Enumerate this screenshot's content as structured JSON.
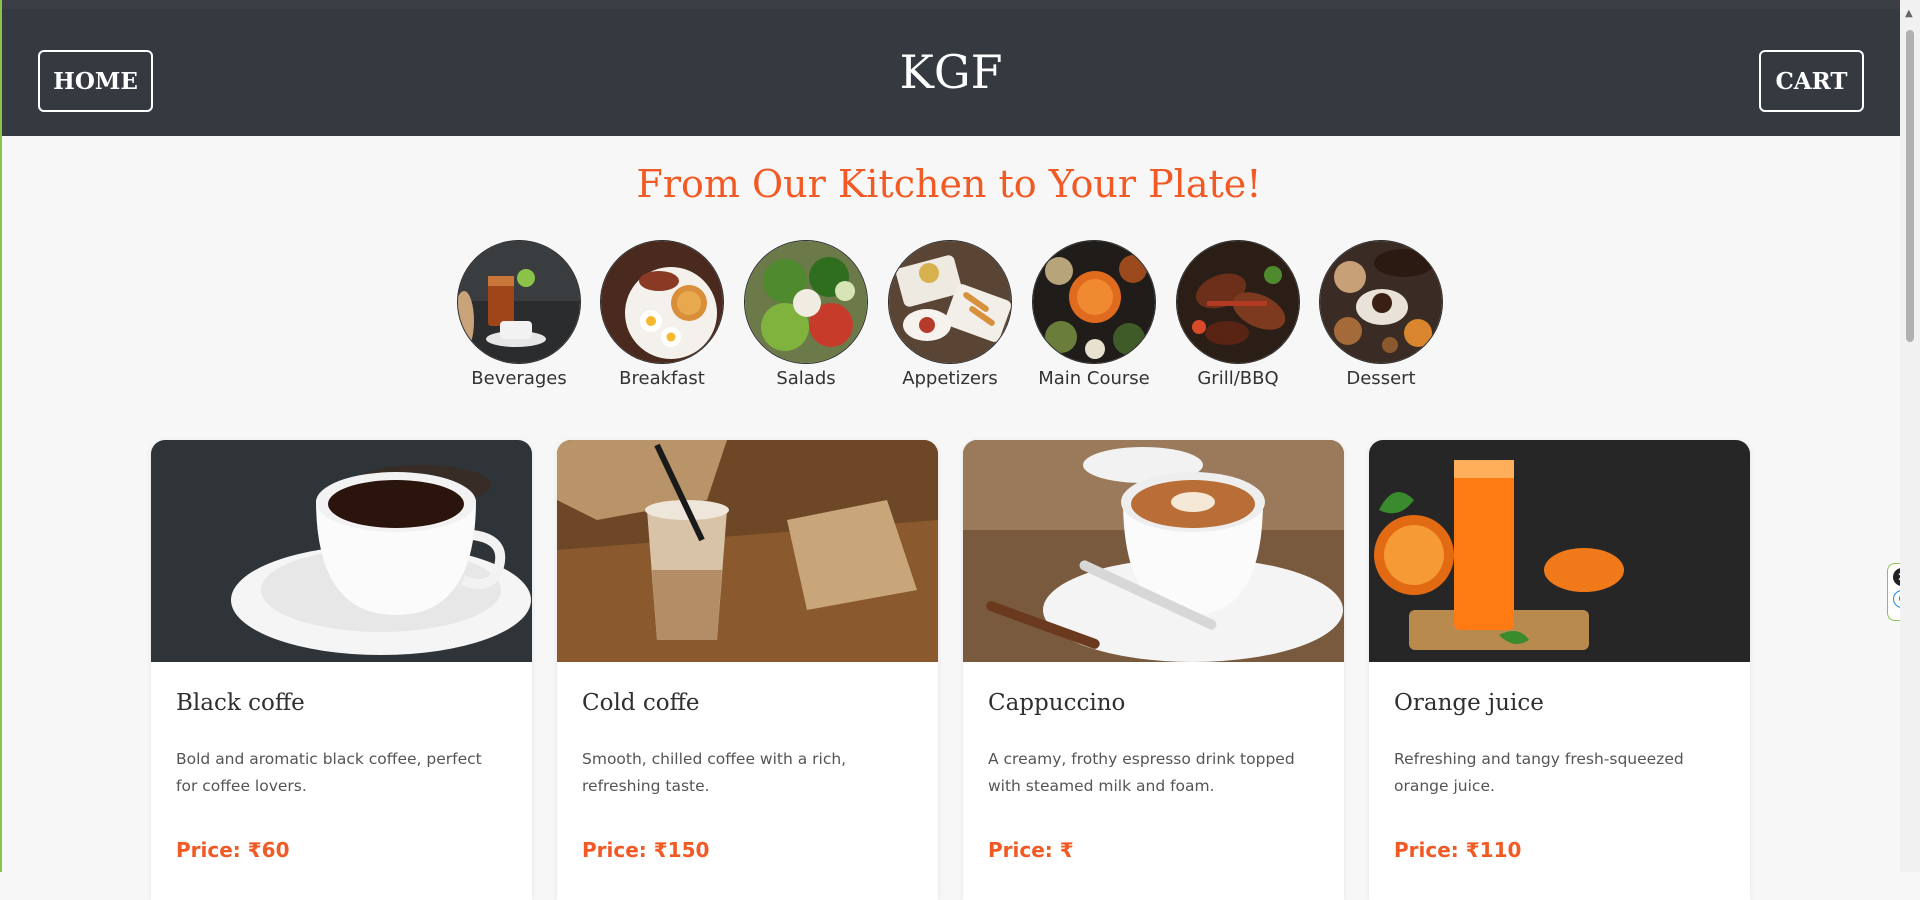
{
  "navbar": {
    "brand": "KGF",
    "home_label": "HOME",
    "cart_label": "CART"
  },
  "tagline": "From Our Kitchen to Your Plate!",
  "categories": [
    {
      "label": "Beverages",
      "icon": "beverages-image"
    },
    {
      "label": "Breakfast",
      "icon": "breakfast-image"
    },
    {
      "label": "Salads",
      "icon": "salads-image"
    },
    {
      "label": "Appetizers",
      "icon": "appetizers-image"
    },
    {
      "label": "Main Course",
      "icon": "main-course-image"
    },
    {
      "label": "Grill/BBQ",
      "icon": "grill-bbq-image"
    },
    {
      "label": "Dessert",
      "icon": "dessert-image"
    }
  ],
  "products": [
    {
      "name": "Black coffe",
      "description": "Bold and aromatic black coffee, perfect for coffee lovers.",
      "price": "Price: ₹60"
    },
    {
      "name": "Cold coffe",
      "description": "Smooth, chilled coffee with a rich, refreshing taste.",
      "price": "Price: ₹150"
    },
    {
      "name": "Cappuccino",
      "description": "A creamy, frothy espresso drink topped with steamed milk and foam.",
      "price": "Price: ₹"
    },
    {
      "name": "Orange juice",
      "description": "Refreshing and tangy fresh-squeezed orange juice.",
      "price": "Price: ₹110"
    }
  ],
  "colors": {
    "navbar_bg": "#343a40",
    "accent": "#f15a24",
    "page_bg": "#f7f7f7"
  },
  "side_widget": {
    "icons": [
      "close-icon",
      "extension-e-icon"
    ]
  }
}
